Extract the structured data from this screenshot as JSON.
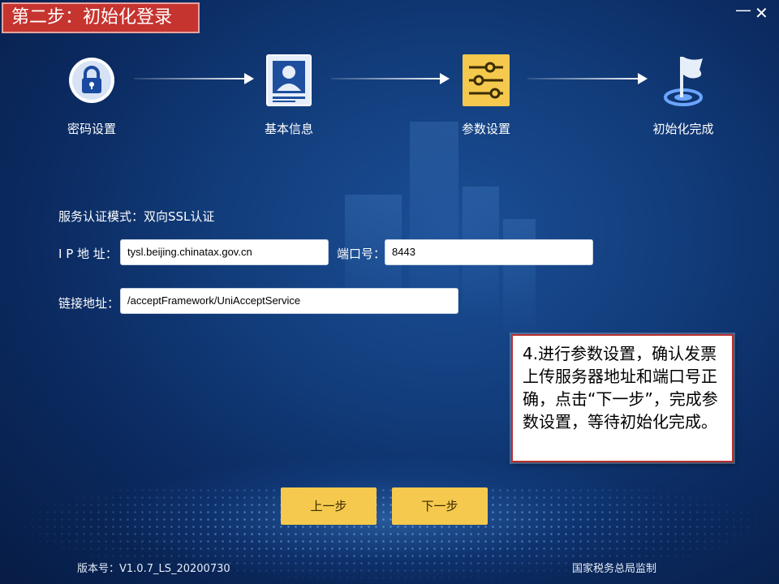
{
  "title": "第二步：初始化登录",
  "window_controls": {
    "minimize": "—",
    "close": "✕"
  },
  "steps": [
    {
      "label": "密码设置",
      "icon": "lock-icon"
    },
    {
      "label": "基本信息",
      "icon": "id-card-icon"
    },
    {
      "label": "参数设置",
      "icon": "sliders-icon",
      "active": true
    },
    {
      "label": "初始化完成",
      "icon": "flag-icon"
    }
  ],
  "form": {
    "mode_text": "服务认证模式：双向SSL认证",
    "ip_label": "I P 地 址：",
    "ip_value": "tysl.beijing.chinatax.gov.cn",
    "port_label": "端口号：",
    "port_value": "8443",
    "link_label": "链接地址：",
    "link_value": "/acceptFramework/UniAcceptService"
  },
  "callout_text": "4.进行参数设置，确认发票上传服务器地址和端口号正确，点击“下一步”，完成参数设置，等待初始化完成。",
  "buttons": {
    "prev": "上一步",
    "next": "下一步"
  },
  "footer": {
    "version": "版本号：V1.0.7_LS_20200730",
    "supervisor": "国家税务总局监制"
  },
  "colors": {
    "accent_yellow": "#f5c94e",
    "title_red": "#c6342f",
    "bg_blue": "#123d7c"
  }
}
